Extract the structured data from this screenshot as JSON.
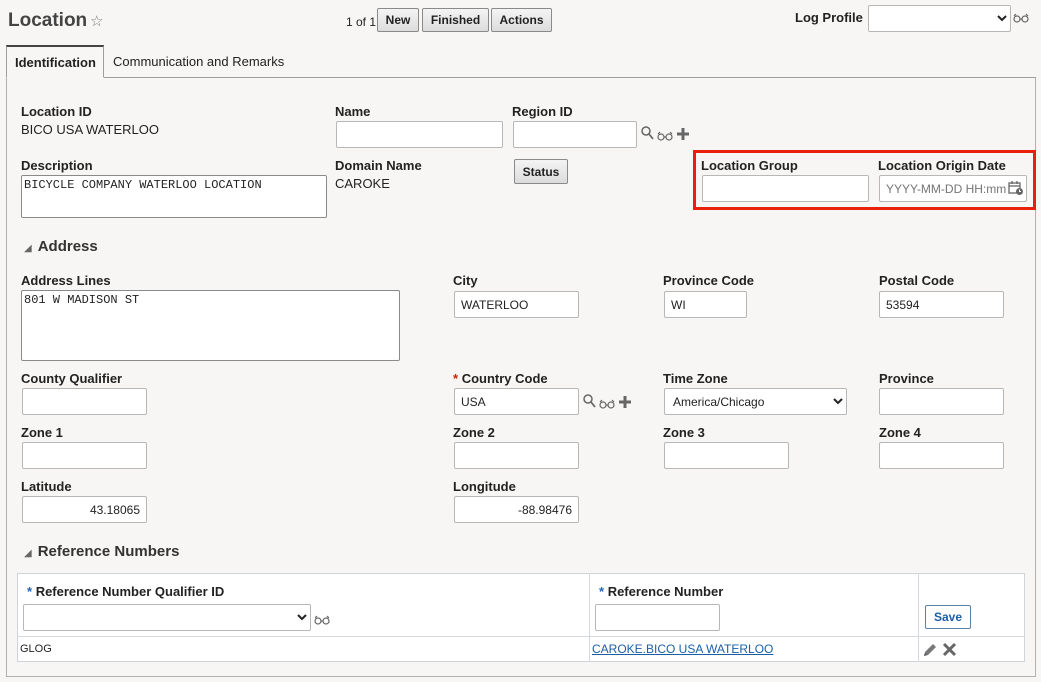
{
  "header": {
    "title": "Location",
    "star_icon": "☆",
    "pager": "1 of 1",
    "new_label": "New",
    "finished_label": "Finished",
    "actions_label": "Actions",
    "log_profile_label": "Log Profile",
    "log_profile_value": ""
  },
  "tabs": [
    {
      "label": "Identification"
    },
    {
      "label": "Communication and Remarks"
    }
  ],
  "identification": {
    "location_id_label": "Location ID",
    "location_id_value": "BICO USA WATERLOO",
    "name_label": "Name",
    "name_value": "",
    "region_id_label": "Region ID",
    "region_id_value": "",
    "description_label": "Description",
    "description_value": "BICYCLE COMPANY WATERLOO LOCATION",
    "domain_name_label": "Domain Name",
    "domain_name_value": "CAROKE",
    "status_label": "Status",
    "location_group_label": "Location Group",
    "location_group_value": "",
    "origin_date_label": "Location Origin Date",
    "origin_date_placeholder": "YYYY-MM-DD HH:mm"
  },
  "address": {
    "section_title": "Address",
    "address_lines_label": "Address Lines",
    "address_lines_value": "801 W MADISON ST",
    "city_label": "City",
    "city_value": "WATERLOO",
    "province_code_label": "Province Code",
    "province_code_value": "WI",
    "postal_code_label": "Postal Code",
    "postal_code_value": "53594",
    "county_qualifier_label": "County Qualifier",
    "county_qualifier_value": "",
    "country_code_label": "Country Code",
    "country_code_value": "USA",
    "time_zone_label": "Time Zone",
    "time_zone_value": "America/Chicago",
    "province_label": "Province",
    "province_value": "",
    "zone1_label": "Zone 1",
    "zone2_label": "Zone 2",
    "zone3_label": "Zone 3",
    "zone4_label": "Zone 4",
    "latitude_label": "Latitude",
    "latitude_value": "43.18065",
    "longitude_label": "Longitude",
    "longitude_value": "-88.98476"
  },
  "reference_numbers": {
    "section_title": "Reference Numbers",
    "qualifier_header": "Reference Number Qualifier ID",
    "number_header": "Reference Number",
    "save_label": "Save",
    "rows": [
      {
        "qualifier": "GLOG",
        "number": "CAROKE.BICO USA WATERLOO"
      }
    ]
  },
  "required_marker": "*",
  "colors": {
    "highlight": "#e8210a",
    "link": "#1a5fa8",
    "required": "#cc2200"
  }
}
